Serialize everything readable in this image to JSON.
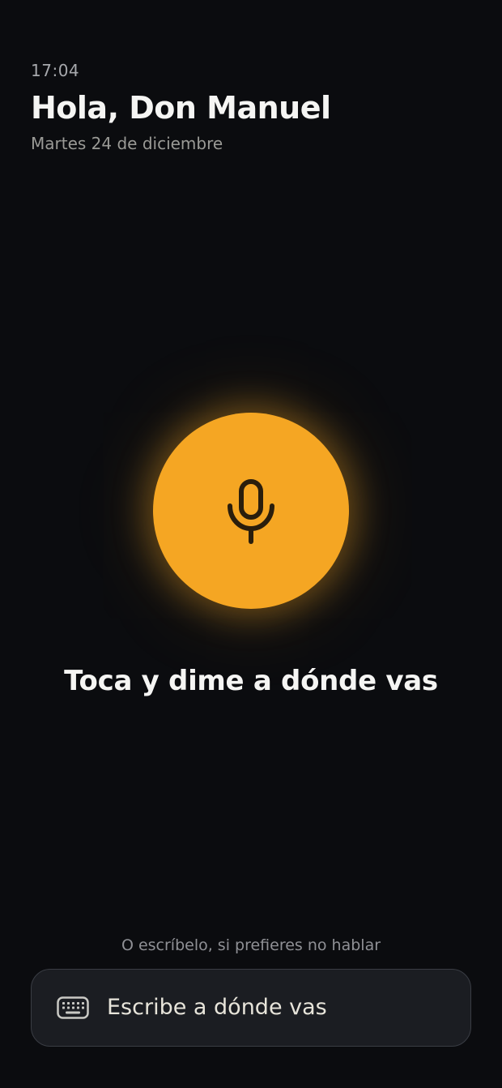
{
  "header": {
    "time": "17:04",
    "greeting": "Hola, Don Manuel",
    "date": "Martes 24 de diciembre"
  },
  "mic": {
    "icon": "microphone-icon",
    "color": "#f5a623"
  },
  "prompt": "Toca y dime a dónde vas",
  "hint": "O escríbelo, si prefieres no hablar",
  "search": {
    "icon": "keyboard-icon",
    "placeholder": "Escribe a dónde vas"
  },
  "colors": {
    "background": "#0b0c0f",
    "accent": "#f5a623",
    "input_background": "#1b1d22"
  }
}
